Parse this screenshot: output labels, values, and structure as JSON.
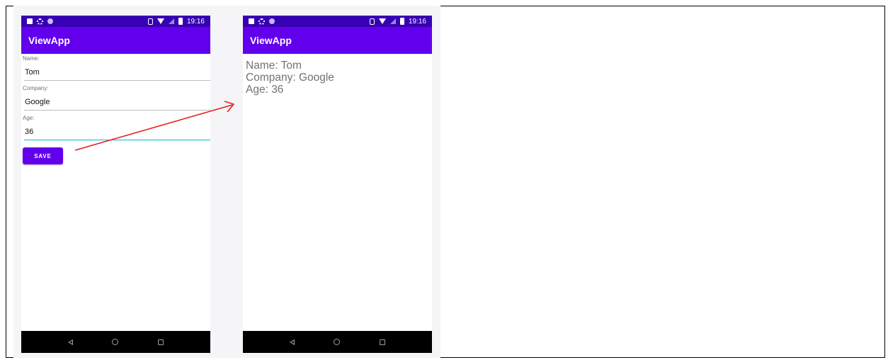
{
  "left_phone": {
    "status_time": "19:16",
    "app_title": "ViewApp",
    "form": {
      "name_label": "Name:",
      "name_value": "Tom",
      "company_label": "Company:",
      "company_value": "Google",
      "age_label": "Age:",
      "age_value": "36",
      "save_label": "SAVE"
    }
  },
  "right_phone": {
    "status_time": "19:16",
    "app_title": "ViewApp",
    "output": {
      "name_line": "Name: Tom",
      "company_line": "Company: Google",
      "age_line": "Age: 36"
    }
  },
  "colors": {
    "status_bar": "#3700b3",
    "app_bar": "#6200ee",
    "button": "#6200ee",
    "active_underline": "#00bcd4",
    "arrow": "#e81e1e"
  }
}
